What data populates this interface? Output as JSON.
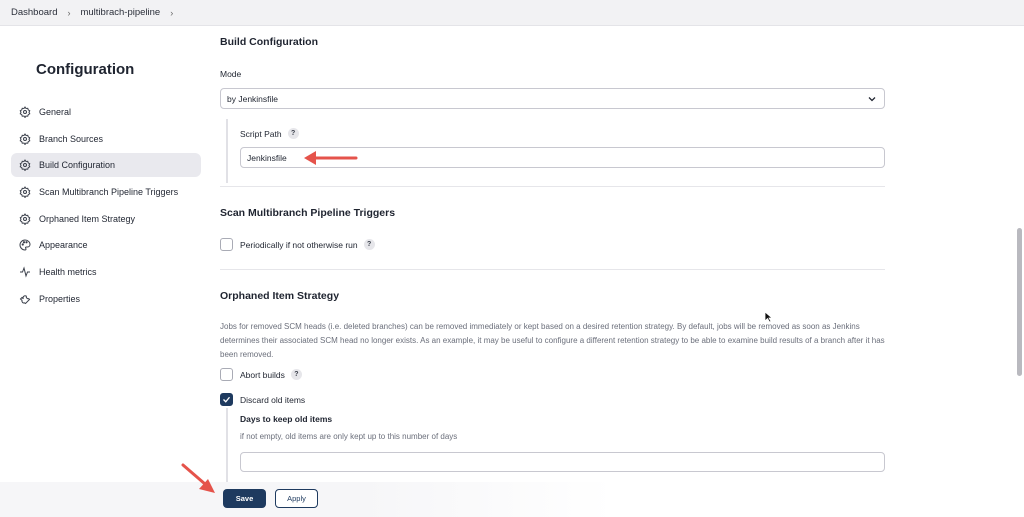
{
  "breadcrumb": [
    "Dashboard",
    "multibrach-pipeline"
  ],
  "page_title": "Configuration",
  "sidebar": {
    "items": [
      {
        "label": "General",
        "icon": "gear-icon",
        "active": false
      },
      {
        "label": "Branch Sources",
        "icon": "gear-icon",
        "active": false
      },
      {
        "label": "Build Configuration",
        "icon": "gear-icon",
        "active": true
      },
      {
        "label": "Scan Multibranch Pipeline Triggers",
        "icon": "gear-icon",
        "active": false
      },
      {
        "label": "Orphaned Item Strategy",
        "icon": "gear-icon",
        "active": false
      },
      {
        "label": "Appearance",
        "icon": "palette-icon",
        "active": false
      },
      {
        "label": "Health metrics",
        "icon": "pulse-icon",
        "active": false
      },
      {
        "label": "Properties",
        "icon": "wrench-icon",
        "active": false
      }
    ]
  },
  "build_configuration": {
    "title": "Build Configuration",
    "mode_label": "Mode",
    "mode_value": "by Jenkinsfile",
    "script_path_label": "Script Path",
    "script_path_value": "Jenkinsfile"
  },
  "scan_triggers": {
    "title": "Scan Multibranch Pipeline Triggers",
    "periodic_label": "Periodically if not otherwise run",
    "periodic_checked": false
  },
  "orphaned": {
    "title": "Orphaned Item Strategy",
    "description": "Jobs for removed SCM heads (i.e. deleted branches) can be removed immediately or kept based on a desired retention strategy. By default, jobs will be removed as soon as Jenkins determines their associated SCM head no longer exists. As an example, it may be useful to configure a different retention strategy to be able to examine build results of a branch after it has been removed.",
    "abort_builds_label": "Abort builds",
    "abort_builds_checked": false,
    "discard_label": "Discard old items",
    "discard_checked": true,
    "days_label": "Days to keep old items",
    "days_hint": "if not empty, old items are only kept up to this number of days",
    "days_value": ""
  },
  "help_glyph": "?",
  "buttons": {
    "save": "Save",
    "apply": "Apply"
  },
  "colors": {
    "accent": "#1e3a5f",
    "annotation_arrow": "#e5534b"
  }
}
